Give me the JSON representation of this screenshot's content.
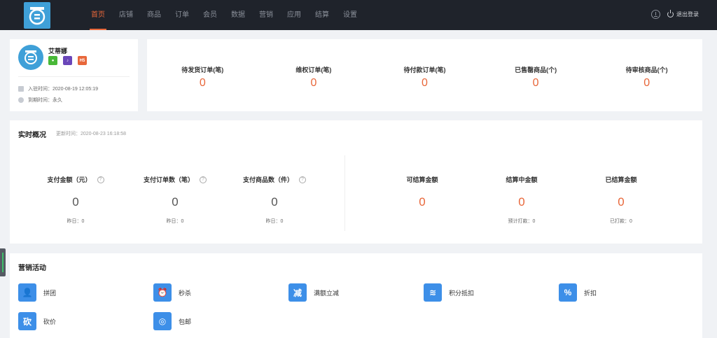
{
  "nav": {
    "items": [
      "首页",
      "店铺",
      "商品",
      "订单",
      "会员",
      "数据",
      "营销",
      "应用",
      "结算",
      "设置"
    ],
    "active_index": 0,
    "logout_label": "退出登录"
  },
  "profile": {
    "shop_name": "艾蒂娜",
    "badges": [
      "wechat-icon",
      "douyin-icon",
      "H5"
    ],
    "join_time": "入驻时间：2020-08-19 12:05:19",
    "expire_time": "到期时间：永久"
  },
  "orders": [
    {
      "label": "待发货订单(笔)",
      "value": "0"
    },
    {
      "label": "维权订单(笔)",
      "value": "0"
    },
    {
      "label": "待付款订单(笔)",
      "value": "0"
    },
    {
      "label": "已售罄商品(个)",
      "value": "0"
    },
    {
      "label": "待审核商品(个)",
      "value": "0"
    }
  ],
  "realtime": {
    "title": "实时概况",
    "update_time": "更新时间：2020-08-23 16:18:58",
    "left": [
      {
        "label": "支付金额（元）",
        "value": "0",
        "sub": "昨日：0"
      },
      {
        "label": "支付订单数（笔）",
        "value": "0",
        "sub": "昨日：0"
      },
      {
        "label": "支付商品数（件）",
        "value": "0",
        "sub": "昨日：0"
      }
    ],
    "right": [
      {
        "label": "可结算金额",
        "value": "0",
        "sub": ""
      },
      {
        "label": "结算中金额",
        "value": "0",
        "sub": "预计打款：0"
      },
      {
        "label": "已结算金额",
        "value": "0",
        "sub": "已打款：0"
      }
    ]
  },
  "marketing": {
    "title": "营销活动",
    "items": [
      {
        "label": "拼团",
        "icon": "group-icon"
      },
      {
        "label": "秒杀",
        "icon": "clock-icon"
      },
      {
        "label": "满额立减",
        "icon": "reduce-icon"
      },
      {
        "label": "积分抵扣",
        "icon": "coins-icon"
      },
      {
        "label": "折扣",
        "icon": "tag-icon"
      },
      {
        "label": "砍价",
        "icon": "cut-icon"
      },
      {
        "label": "包邮",
        "icon": "shipping-icon"
      }
    ]
  },
  "colors": {
    "accent": "#e8673a",
    "nav_bg": "#1f232b",
    "icon_blue": "#3d8fe8"
  }
}
